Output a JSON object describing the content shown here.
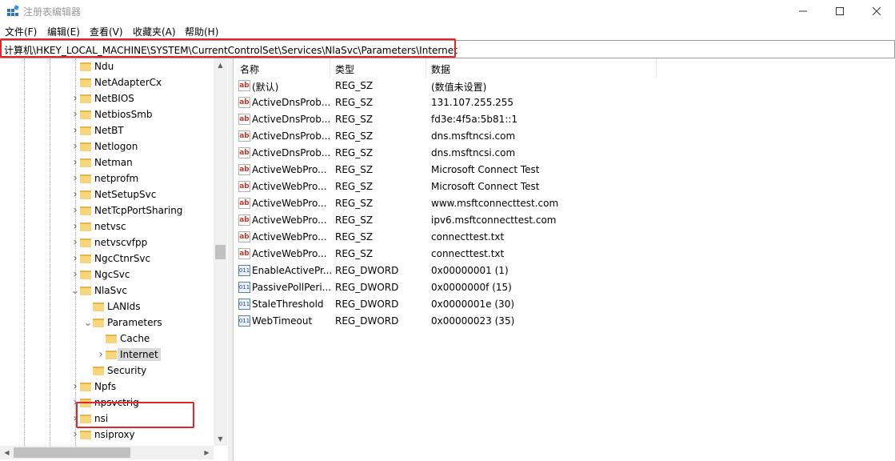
{
  "window": {
    "title": "注册表编辑器"
  },
  "menu": [
    "文件(F)",
    "编辑(E)",
    "查看(V)",
    "收藏夹(A)",
    "帮助(H)"
  ],
  "address": "计算机\\HKEY_LOCAL_MACHINE\\SYSTEM\\CurrentControlSet\\Services\\NlaSvc\\Parameters\\Internet",
  "tree": [
    {
      "label": "Ndu",
      "level": 0,
      "expander": ""
    },
    {
      "label": "NetAdapterCx",
      "level": 0,
      "expander": ""
    },
    {
      "label": "NetBIOS",
      "level": 0,
      "expander": ">"
    },
    {
      "label": "NetbiosSmb",
      "level": 0,
      "expander": ">"
    },
    {
      "label": "NetBT",
      "level": 0,
      "expander": ">"
    },
    {
      "label": "Netlogon",
      "level": 0,
      "expander": ">"
    },
    {
      "label": "Netman",
      "level": 0,
      "expander": ">"
    },
    {
      "label": "netprofm",
      "level": 0,
      "expander": ">"
    },
    {
      "label": "NetSetupSvc",
      "level": 0,
      "expander": ">"
    },
    {
      "label": "NetTcpPortSharing",
      "level": 0,
      "expander": ">"
    },
    {
      "label": "netvsc",
      "level": 0,
      "expander": ">"
    },
    {
      "label": "netvscvfpp",
      "level": 0,
      "expander": ">"
    },
    {
      "label": "NgcCtnrSvc",
      "level": 0,
      "expander": ">"
    },
    {
      "label": "NgcSvc",
      "level": 0,
      "expander": ">"
    },
    {
      "label": "NlaSvc",
      "level": 0,
      "expander": "v"
    },
    {
      "label": "LANIds",
      "level": 1,
      "expander": ""
    },
    {
      "label": "Parameters",
      "level": 1,
      "expander": "v"
    },
    {
      "label": "Cache",
      "level": 2,
      "expander": ""
    },
    {
      "label": "Internet",
      "level": 2,
      "expander": ">",
      "selected": true
    },
    {
      "label": "Security",
      "level": 1,
      "expander": ""
    },
    {
      "label": "Npfs",
      "level": 0,
      "expander": ">"
    },
    {
      "label": "npsvctrig",
      "level": 0,
      "expander": ">"
    },
    {
      "label": "nsi",
      "level": 0,
      "expander": ">"
    },
    {
      "label": "nsiproxy",
      "level": 0,
      "expander": ">"
    }
  ],
  "columns": {
    "name": "名称",
    "type": "类型",
    "data": "数据"
  },
  "values": [
    {
      "icon": "string-value-icon",
      "name": "(默认)",
      "type": "REG_SZ",
      "data": "(数值未设置)"
    },
    {
      "icon": "string-value-icon",
      "name": "ActiveDnsProb...",
      "type": "REG_SZ",
      "data": "131.107.255.255"
    },
    {
      "icon": "string-value-icon",
      "name": "ActiveDnsProb...",
      "type": "REG_SZ",
      "data": "fd3e:4f5a:5b81::1"
    },
    {
      "icon": "string-value-icon",
      "name": "ActiveDnsProb...",
      "type": "REG_SZ",
      "data": "dns.msftncsi.com"
    },
    {
      "icon": "string-value-icon",
      "name": "ActiveDnsProb...",
      "type": "REG_SZ",
      "data": "dns.msftncsi.com"
    },
    {
      "icon": "string-value-icon",
      "name": "ActiveWebPro...",
      "type": "REG_SZ",
      "data": "Microsoft Connect Test"
    },
    {
      "icon": "string-value-icon",
      "name": "ActiveWebPro...",
      "type": "REG_SZ",
      "data": "Microsoft Connect Test"
    },
    {
      "icon": "string-value-icon",
      "name": "ActiveWebPro...",
      "type": "REG_SZ",
      "data": "www.msftconnecttest.com"
    },
    {
      "icon": "string-value-icon",
      "name": "ActiveWebPro...",
      "type": "REG_SZ",
      "data": "ipv6.msftconnecttest.com"
    },
    {
      "icon": "string-value-icon",
      "name": "ActiveWebPro...",
      "type": "REG_SZ",
      "data": "connecttest.txt"
    },
    {
      "icon": "string-value-icon",
      "name": "ActiveWebPro...",
      "type": "REG_SZ",
      "data": "connecttest.txt"
    },
    {
      "icon": "dword-value-icon",
      "name": "EnableActivePr...",
      "type": "REG_DWORD",
      "data": "0x00000001 (1)"
    },
    {
      "icon": "dword-value-icon",
      "name": "PassivePollPeri...",
      "type": "REG_DWORD",
      "data": "0x0000000f (15)"
    },
    {
      "icon": "dword-value-icon",
      "name": "StaleThreshold",
      "type": "REG_DWORD",
      "data": "0x0000001e (30)"
    },
    {
      "icon": "dword-value-icon",
      "name": "WebTimeout",
      "type": "REG_DWORD",
      "data": "0x00000023 (35)"
    }
  ],
  "icons": {
    "string": "ab",
    "dword": "011"
  },
  "colors": {
    "highlight": "#e3242b",
    "folder": "#f6d57c",
    "selection": "#d9d9d9"
  }
}
